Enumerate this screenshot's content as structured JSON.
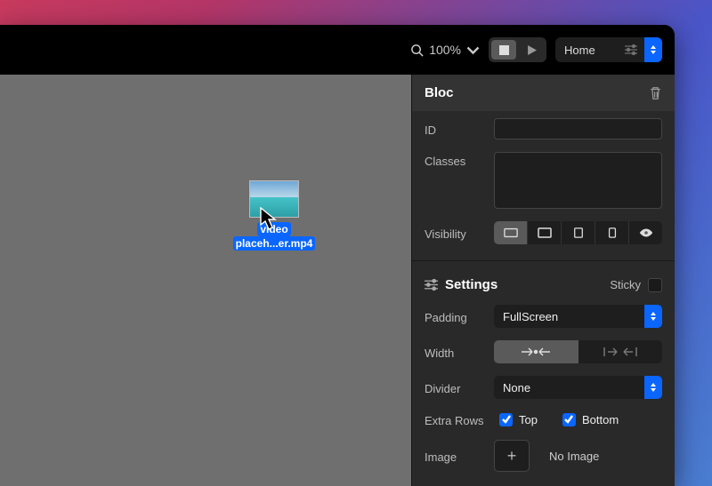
{
  "toolbar": {
    "zoom": "100%",
    "page_selector": "Home"
  },
  "canvas": {
    "dragged_file": {
      "name_line1": "video",
      "name_line2": "placeh...er.mp4"
    }
  },
  "sidebar": {
    "panel_title": "Bloc",
    "labels": {
      "id": "ID",
      "classes": "Classes",
      "visibility": "Visibility"
    },
    "settings": {
      "title": "Settings",
      "sticky_label": "Sticky",
      "sticky_checked": false,
      "padding_label": "Padding",
      "padding_value": "FullScreen",
      "width_label": "Width",
      "divider_label": "Divider",
      "divider_value": "None",
      "extra_rows_label": "Extra Rows",
      "top_label": "Top",
      "top_checked": true,
      "bottom_label": "Bottom",
      "bottom_checked": true,
      "image_label": "Image",
      "image_value": "No Image"
    }
  }
}
